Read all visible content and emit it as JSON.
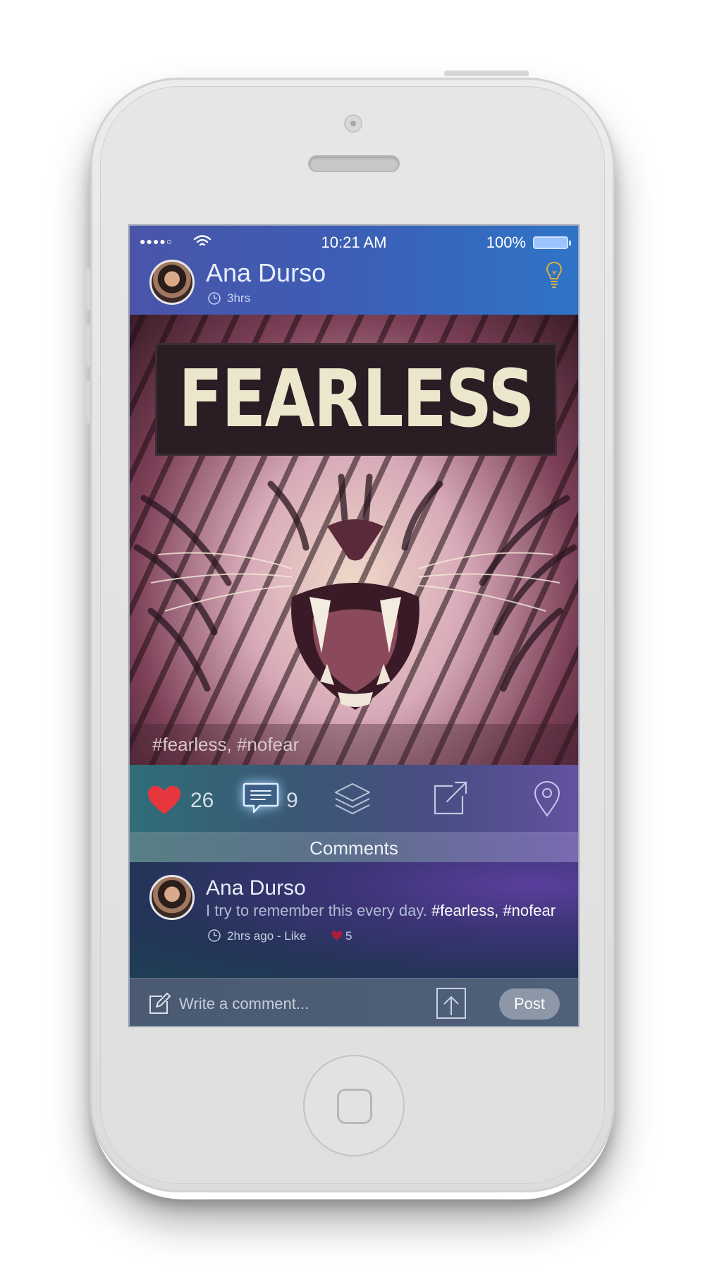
{
  "status_bar": {
    "signal": "●●●●○",
    "time": "10:21 AM",
    "battery": "100%"
  },
  "post": {
    "author": "Ana Durso",
    "time": "3hrs",
    "photo_title": "FEARLESS",
    "hashtags": "#fearless, #nofear"
  },
  "actions": {
    "likes": "26",
    "comments": "9"
  },
  "comments_header": "Comments",
  "comment": {
    "author": "Ana Durso",
    "text": "I try to remember this every day.",
    "tags": "#fearless, #nofear",
    "meta": "2hrs ago  -  Like",
    "likes": "5"
  },
  "input": {
    "placeholder": "Write a comment...",
    "post_label": "Post"
  },
  "colors": {
    "heart": "#e8363f",
    "topbar_start": "#4a55a8",
    "topbar_end": "#2f74c7",
    "bulb": "#d9b33a"
  }
}
